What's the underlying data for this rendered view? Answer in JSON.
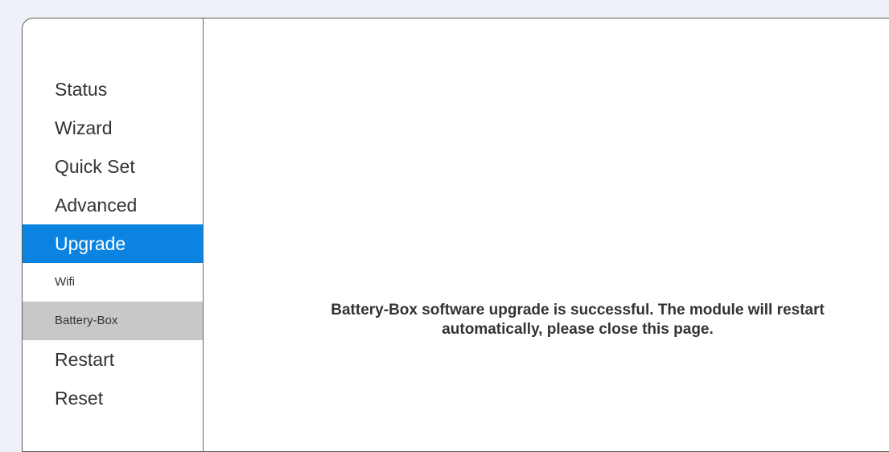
{
  "sidebar": {
    "items": [
      {
        "label": "Status",
        "state": "normal"
      },
      {
        "label": "Wizard",
        "state": "normal"
      },
      {
        "label": "Quick Set",
        "state": "normal"
      },
      {
        "label": "Advanced",
        "state": "normal"
      },
      {
        "label": "Upgrade",
        "state": "active"
      },
      {
        "label": "Wifi",
        "state": "sub"
      },
      {
        "label": "Battery-Box",
        "state": "sub-selected"
      },
      {
        "label": "Restart",
        "state": "normal"
      },
      {
        "label": "Reset",
        "state": "normal"
      }
    ]
  },
  "main": {
    "message": "Battery-Box software upgrade is successful. The module will restart automatically, please close this page."
  },
  "colors": {
    "page_background": "#eef2f8",
    "active_item": "#0a84e0",
    "selected_subitem": "#c8c8c8",
    "text": "#333333"
  }
}
